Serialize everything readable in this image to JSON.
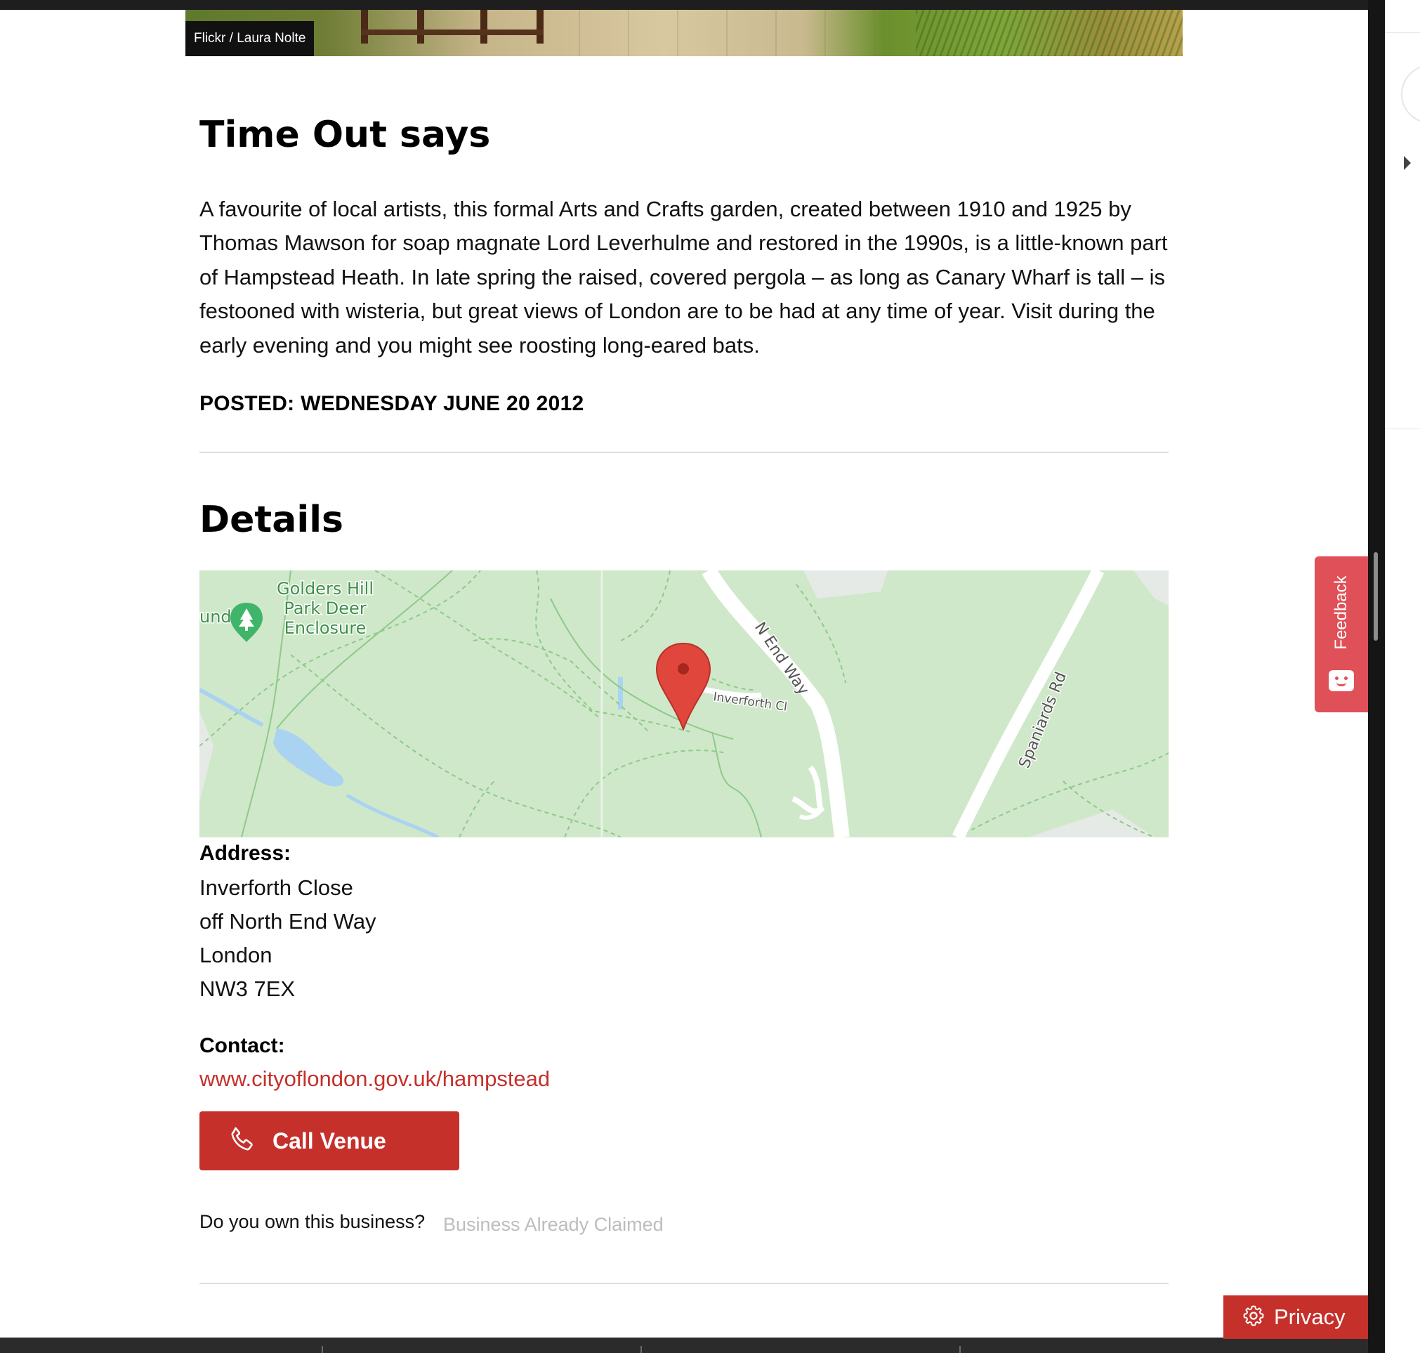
{
  "hero": {
    "credit": "Flickr / Laura Nolte"
  },
  "review": {
    "heading": "Time Out says",
    "body": "A favourite of local artists, this formal Arts and Crafts garden, created between 1910 and 1925 by Thomas Mawson for soap magnate Lord Leverhulme and restored in the 1990s, is a little-known part of Hampstead Heath. In late spring the raised, covered pergola – as long as Canary Wharf is tall – is festooned with wisteria, but great views of London are to be had at any time of year. Visit during the early evening and you might see roosting long-eared bats.",
    "posted": "POSTED: WEDNESDAY JUNE 20 2012"
  },
  "details": {
    "heading": "Details",
    "map": {
      "poi_label_lines": [
        "Golders Hill",
        "Park Deer",
        "Enclosure"
      ],
      "partial_label": "und",
      "road_n_end_way": "N End Way",
      "road_inverforth": "Inverforth Cl",
      "road_spaniards": "Spaniards Rd",
      "pin_icon": "map-pin-icon",
      "poi_icon": "tree-icon"
    },
    "address_label": "Address:",
    "address_lines": [
      "Inverforth Close",
      "off North End Way",
      "London",
      "NW3 7EX"
    ],
    "contact_label": "Contact:",
    "contact_link": "www.cityoflondon.gov.uk/hampstead",
    "call_button": "Call Venue",
    "own_question": "Do you own this business?",
    "claimed_text": "Business Already Claimed"
  },
  "widgets": {
    "feedback": "Feedback",
    "privacy": "Privacy"
  },
  "colors": {
    "accent": "#c5302b",
    "feedback": "#e05058",
    "map_park": "#cfe8c9",
    "link": "#c5302b"
  }
}
